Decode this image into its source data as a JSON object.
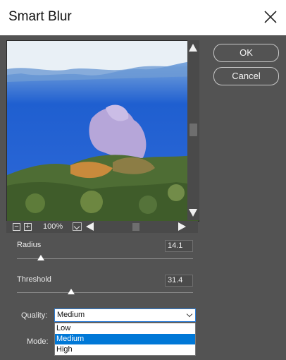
{
  "window": {
    "title": "Smart Blur"
  },
  "buttons": {
    "ok": "OK",
    "cancel": "Cancel"
  },
  "preview": {
    "zoom": "100%",
    "zoom_out": "−",
    "zoom_in": "+"
  },
  "radius": {
    "label": "Radius",
    "value": "14.1"
  },
  "threshold": {
    "label": "Threshold",
    "value": "31.4"
  },
  "quality": {
    "label": "Quality:",
    "selected": "Medium",
    "options": [
      "Low",
      "Medium",
      "High"
    ]
  },
  "mode": {
    "label": "Mode:"
  },
  "colors": {
    "accent": "#0078d7",
    "background": "#535353"
  }
}
